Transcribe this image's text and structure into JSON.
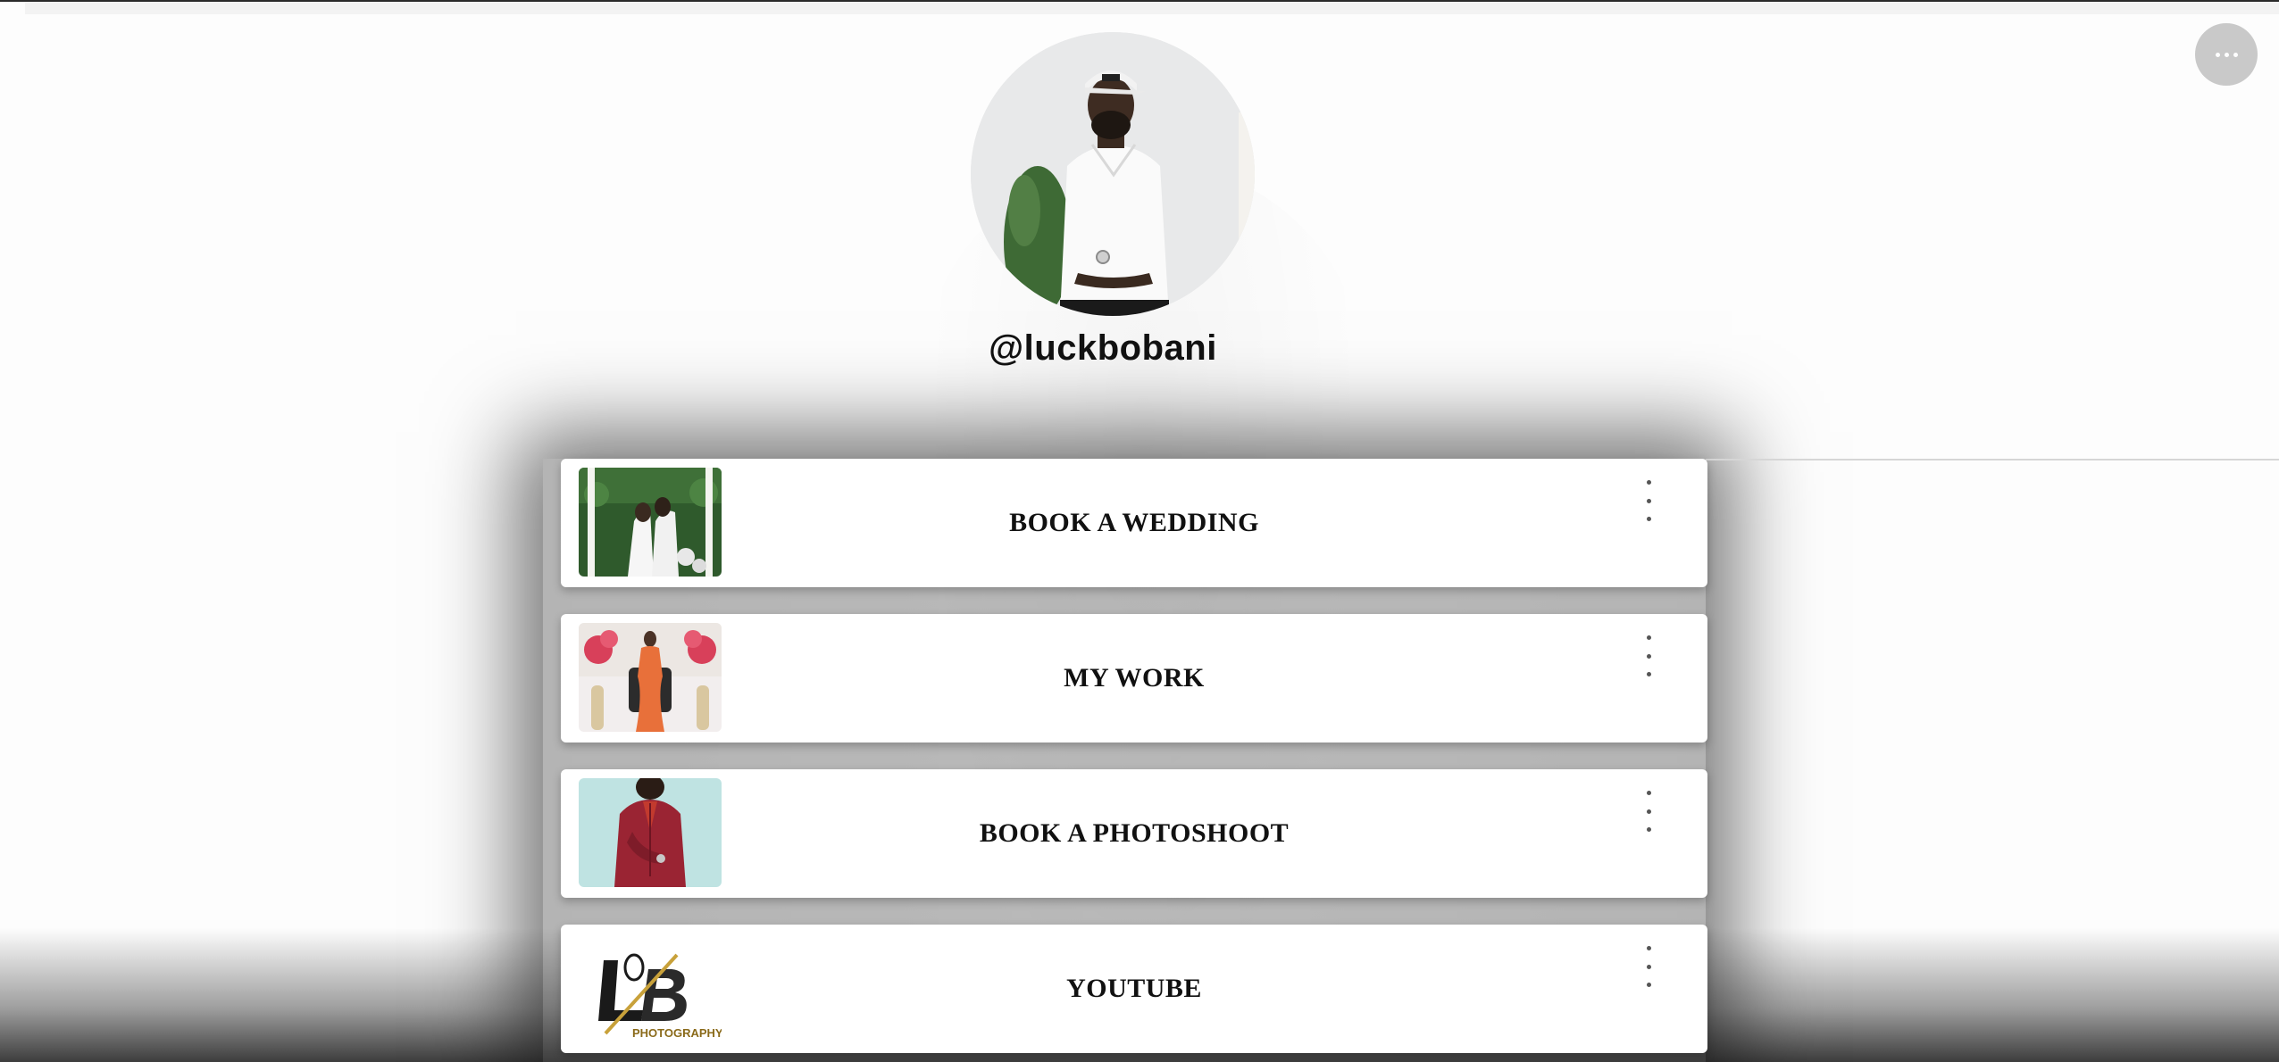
{
  "profile": {
    "username": "@luckbobani"
  },
  "menu": {
    "icon": "more-horizontal-icon"
  },
  "links": [
    {
      "title": "BOOK A WEDDING",
      "thumbnail": "wedding-couple-photo"
    },
    {
      "title": "MY WORK",
      "thumbnail": "orange-gown-portrait-photo"
    },
    {
      "title": "BOOK A PHOTOSHOOT",
      "thumbnail": "red-suit-portrait-photo"
    },
    {
      "title": "YOUTUBE",
      "thumbnail": "lb-photography-logo",
      "logo_text": "LB PHOTOGRAPHY"
    }
  ],
  "colors": {
    "menu_button": "#c9c9c9",
    "card_background": "#ffffff",
    "text": "#111111",
    "logo_gold": "#c8a13a"
  }
}
